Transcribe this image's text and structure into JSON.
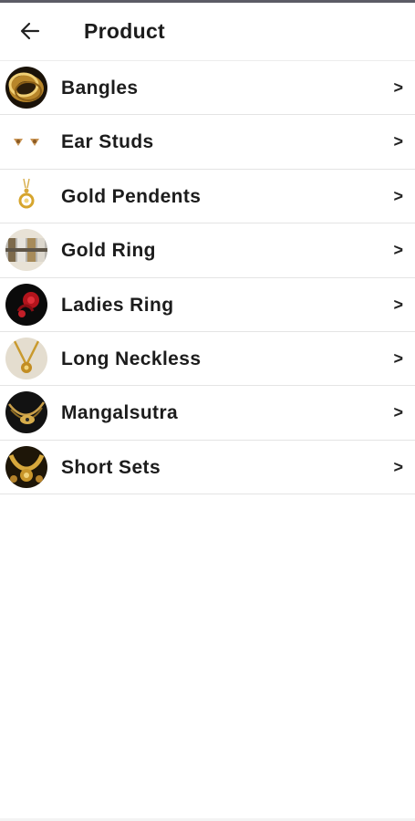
{
  "header": {
    "back_icon": "arrow-left-icon",
    "title": "Product"
  },
  "colors": {
    "accent_gold": "#c9962b",
    "text": "#1c1c1c",
    "divider": "#e4e4e4"
  },
  "products": [
    {
      "label": "Bangles",
      "icon": "bangles-thumbnail",
      "chevron": ">"
    },
    {
      "label": "Ear Studs",
      "icon": "ear-studs-thumbnail",
      "chevron": ">"
    },
    {
      "label": "Gold Pendents",
      "icon": "gold-pendent-thumbnail",
      "chevron": ">"
    },
    {
      "label": "Gold Ring",
      "icon": "gold-ring-thumbnail",
      "chevron": ">"
    },
    {
      "label": "Ladies Ring",
      "icon": "ladies-ring-thumbnail",
      "chevron": ">"
    },
    {
      "label": "Long Neckless",
      "icon": "long-necklace-thumbnail",
      "chevron": ">"
    },
    {
      "label": "Mangalsutra",
      "icon": "mangalsutra-thumbnail",
      "chevron": ">"
    },
    {
      "label": "Short Sets",
      "icon": "short-sets-thumbnail",
      "chevron": ">"
    }
  ]
}
